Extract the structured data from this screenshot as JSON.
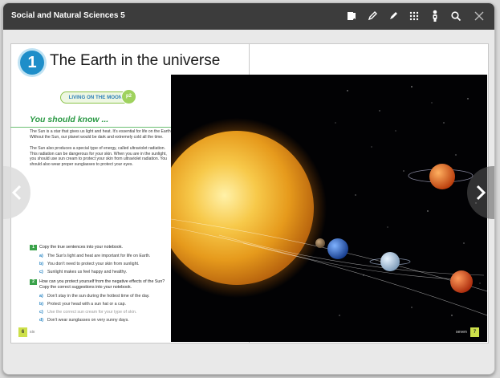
{
  "app": {
    "title": "Social and Natural Sciences 5",
    "toolbar": [
      {
        "icon": "book-bookmark-icon"
      },
      {
        "icon": "pencil-icon"
      },
      {
        "icon": "marker-icon"
      },
      {
        "icon": "grid-menu-icon"
      },
      {
        "icon": "user-settings-icon"
      },
      {
        "icon": "search-icon"
      },
      {
        "icon": "close-icon"
      }
    ]
  },
  "left_page": {
    "unit_number": "1",
    "unit_title": "The Earth in the universe",
    "living_on_the_moon": "LIVING ON THE MOON",
    "living_badge": "p2",
    "section_heading": "You should know ...",
    "paragraphs": [
      "The Sun is a star that gives us light and heat. It's essential for life on the Earth. Without the Sun, our planet would be dark and extremely cold all the time.",
      "The Sun also produces a special type of energy, called ultraviolet radiation. This radiation can be dangerous for your skin. When you are in the sunlight, you should use sun cream to protect your skin from ultraviolet radiation. You should also wear proper sunglasses to protect your eyes."
    ],
    "activities": [
      {
        "number": "1",
        "prompt": "Copy the true sentences into your notebook.",
        "options": [
          {
            "letter": "a)",
            "text": "The Sun's light and heat are important for life on Earth."
          },
          {
            "letter": "b)",
            "text": "You don't need to protect your skin from sunlight."
          },
          {
            "letter": "c)",
            "text": "Sunlight makes us feel happy and healthy."
          }
        ]
      },
      {
        "number": "2",
        "prompt": "How can you protect yourself from the negative effects of the Sun? Copy the correct suggestions into your notebook.",
        "options": [
          {
            "letter": "a)",
            "text": "Don't stay in the sun during the hottest time of the day."
          },
          {
            "letter": "b)",
            "text": "Protect your head with a sun hat or a cap."
          },
          {
            "letter": "c)",
            "text": "Use the correct sun cream for your type of skin."
          },
          {
            "letter": "d)",
            "text": "Don't wear sunglasses on very sunny days."
          }
        ]
      }
    ],
    "page_number": "6",
    "page_word": "six"
  },
  "right_page": {
    "page_number": "7",
    "page_word": "seven"
  },
  "navigation": {
    "prev_icon": "chevron-left-icon",
    "next_icon": "chevron-right-icon"
  },
  "colors": {
    "topbar": "#3c3c3c",
    "unit_blue": "#1e8ec9",
    "section_green": "#2b9a45",
    "page_tab": "#cde04a"
  }
}
